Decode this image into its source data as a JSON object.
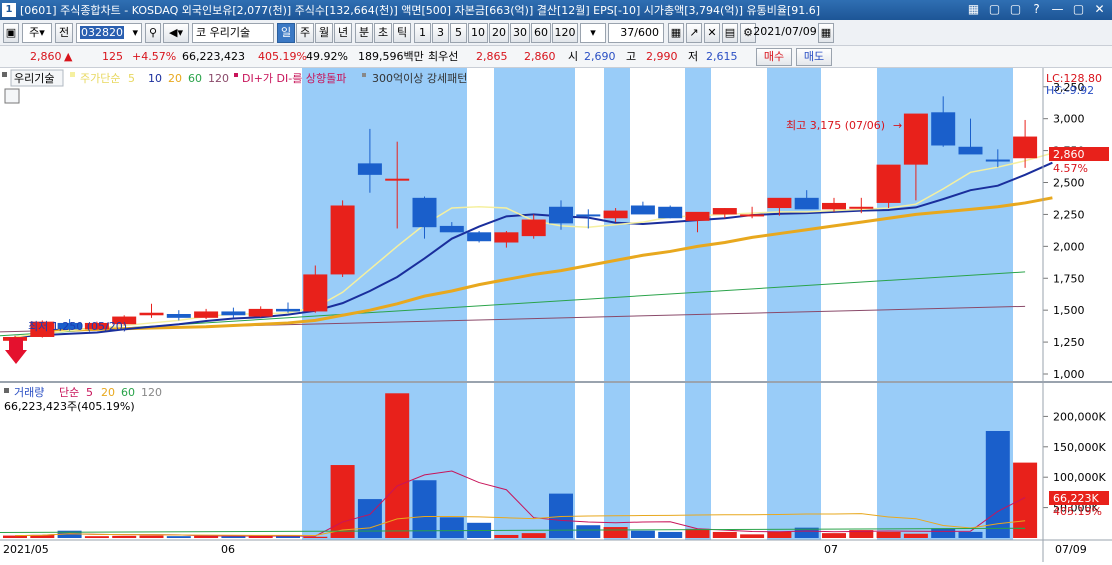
{
  "window": {
    "title": "[0601] 주식종합차트 - KOSDAQ 외국인보유[2,077(천)]  주식수[132,664(천)]  액면[500]  자본금[663(억)]  결산[12월]  EPS[-10]  시가총액[3,794(억)]  유통비율[91.6]",
    "icon_label": "1",
    "controls": [
      "▦",
      "▢",
      "▢",
      "?",
      "—",
      "▢",
      "✕"
    ]
  },
  "toolbar": {
    "type_select": "주",
    "all_button": "전",
    "code_value": "032820",
    "stock_prefix": "코",
    "stock_name": "우리기술",
    "periods": [
      "일",
      "주",
      "월",
      "년",
      "분",
      "초",
      "틱"
    ],
    "active_period": "일",
    "minutes": [
      "1",
      "3",
      "5",
      "10",
      "20",
      "30",
      "60",
      "120"
    ],
    "count": "37/600",
    "date": "2021/07/09"
  },
  "quote": {
    "price": "2,860",
    "arrow": "▲",
    "change": "125",
    "change_pct": "+4.57%",
    "volume": "66,223,423",
    "vol_ratio": "405.19%",
    "ratio2": "49.92%",
    "amount": "189,596백만",
    "best_label": "최우선",
    "ask": "2,865",
    "bid": "2,860",
    "open_label": "시",
    "open": "2,690",
    "high_label": "고",
    "high": "2,990",
    "low_label": "저",
    "low": "2,615",
    "buy_button": "매수",
    "sell_button": "매도"
  },
  "price_panel": {
    "stock_tag": "우리기술",
    "ma_label": "주가단순",
    "ma_periods": [
      "5",
      "10",
      "20",
      "60",
      "120"
    ],
    "signal1": "DI+가 DI-를 상향돌파",
    "signal2": "300억이상 강세패턴",
    "lc": "LC:128.80",
    "hc": "HC:-9.92",
    "max_annotation": "최고 3,175 (07/06)",
    "min_annotation": "최저 1,250 (05/20)",
    "last_price_tag": "2,860",
    "last_pct_tag": "4.57%"
  },
  "volume_panel": {
    "label": "거래량",
    "ma_label": "단순",
    "ma_periods": [
      "5",
      "20",
      "60",
      "120"
    ],
    "current": "66,223,423주(405.19%)",
    "last_tag": "66,223K",
    "last_pct_tag": "405.19%"
  },
  "x_labels": {
    "start": "2021/05",
    "m6": "06",
    "m7": "07",
    "end": "07/09"
  },
  "colors": {
    "up": "#e8211b",
    "down": "#1a5fcb",
    "highlight": "#99ccf8",
    "ma5": "#f5f0a0",
    "ma10": "#1a2e9c",
    "ma20": "#e8a81e",
    "ma60": "#2aa34a",
    "ma120": "#8a4a6a"
  },
  "chart_data": {
    "type": "candlestick",
    "dates": [
      "05/14",
      "05/17",
      "05/18",
      "05/20",
      "05/21",
      "05/24",
      "05/25",
      "05/26",
      "05/27",
      "05/28",
      "05/31",
      "06/01",
      "06/02",
      "06/03",
      "06/04",
      "06/07",
      "06/08",
      "06/09",
      "06/10",
      "06/11",
      "06/14",
      "06/15",
      "06/16",
      "06/17",
      "06/18",
      "06/21",
      "06/22",
      "06/23",
      "06/24",
      "06/25",
      "06/28",
      "06/29",
      "06/30",
      "07/01",
      "07/02",
      "07/05",
      "07/06",
      "07/07",
      "07/08",
      "07/09"
    ],
    "ohlc": [
      [
        1260,
        1300,
        1250,
        1290
      ],
      [
        1290,
        1420,
        1285,
        1410
      ],
      [
        1400,
        1430,
        1340,
        1350
      ],
      [
        1350,
        1410,
        1345,
        1400
      ],
      [
        1390,
        1460,
        1380,
        1450
      ],
      [
        1460,
        1550,
        1440,
        1480
      ],
      [
        1470,
        1500,
        1420,
        1440
      ],
      [
        1440,
        1510,
        1430,
        1490
      ],
      [
        1490,
        1520,
        1440,
        1460
      ],
      [
        1450,
        1530,
        1445,
        1510
      ],
      [
        1510,
        1560,
        1480,
        1490
      ],
      [
        1490,
        1850,
        1480,
        1780
      ],
      [
        1780,
        2360,
        1760,
        2320
      ],
      [
        2650,
        2920,
        2420,
        2560
      ],
      [
        2530,
        2820,
        2140,
        2530
      ],
      [
        2380,
        2390,
        2060,
        2150
      ],
      [
        2160,
        2190,
        2110,
        2110
      ],
      [
        2110,
        2120,
        2030,
        2040
      ],
      [
        2030,
        2120,
        1990,
        2110
      ],
      [
        2080,
        2250,
        2060,
        2210
      ],
      [
        2310,
        2360,
        2130,
        2180
      ],
      [
        2250,
        2290,
        2140,
        2240
      ],
      [
        2220,
        2300,
        2190,
        2280
      ],
      [
        2320,
        2350,
        2270,
        2250
      ],
      [
        2310,
        2320,
        2220,
        2220
      ],
      [
        2200,
        2250,
        2110,
        2270
      ],
      [
        2250,
        2300,
        2220,
        2300
      ],
      [
        2250,
        2310,
        2220,
        2250
      ],
      [
        2300,
        2330,
        2240,
        2380
      ],
      [
        2380,
        2440,
        2320,
        2290
      ],
      [
        2290,
        2380,
        2270,
        2340
      ],
      [
        2310,
        2380,
        2260,
        2310
      ],
      [
        2340,
        2360,
        2300,
        2640
      ],
      [
        2640,
        2990,
        2360,
        3040
      ],
      [
        3050,
        3175,
        2780,
        2790
      ],
      [
        2780,
        3000,
        2750,
        2720
      ],
      [
        2680,
        2760,
        2620,
        2670
      ],
      [
        2690,
        2990,
        2615,
        2860
      ]
    ],
    "volume_k": [
      4000,
      5000,
      12000,
      3000,
      3500,
      4000,
      3000,
      3500,
      2500,
      3000,
      4500,
      2000,
      120000,
      64000,
      238000,
      95000,
      34000,
      25000,
      5000,
      8000,
      73000,
      21000,
      18000,
      12000,
      10000,
      15000,
      10000,
      6000,
      10000,
      17000,
      8000,
      13000,
      10000,
      7000,
      16000,
      10000,
      176000,
      124000,
      50000,
      66223
    ],
    "ma5_price": [
      1290,
      1320,
      1340,
      1360,
      1380,
      1400,
      1420,
      1450,
      1470,
      1470,
      1480,
      1520,
      1640,
      1820,
      2000,
      2170,
      2300,
      2310,
      2300,
      2200,
      2160,
      2150,
      2170,
      2190,
      2230,
      2240,
      2250,
      2260,
      2270,
      2270,
      2280,
      2290,
      2300,
      2330,
      2450,
      2580,
      2620,
      2670,
      2730
    ],
    "ma20_price": [
      1340,
      1345,
      1350,
      1355,
      1360,
      1365,
      1370,
      1380,
      1390,
      1400,
      1420,
      1460,
      1500,
      1550,
      1610,
      1650,
      1700,
      1740,
      1780,
      1810,
      1850,
      1890,
      1930,
      1960,
      2000,
      2030,
      2070,
      2100,
      2130,
      2160,
      2190,
      2220,
      2250,
      2270,
      2290,
      2310,
      2340,
      2380
    ],
    "ylim": [
      1000,
      3350
    ],
    "vol_ylim": [
      0,
      250000
    ],
    "y_ticks": [
      "3,250",
      "3,000",
      "2,750",
      "2,500",
      "2,250",
      "2,000",
      "1,750",
      "1,500",
      "1,250",
      "1,000"
    ],
    "vol_ticks": [
      "200,000K",
      "150,000K",
      "100,000K",
      "50,000K"
    ]
  }
}
